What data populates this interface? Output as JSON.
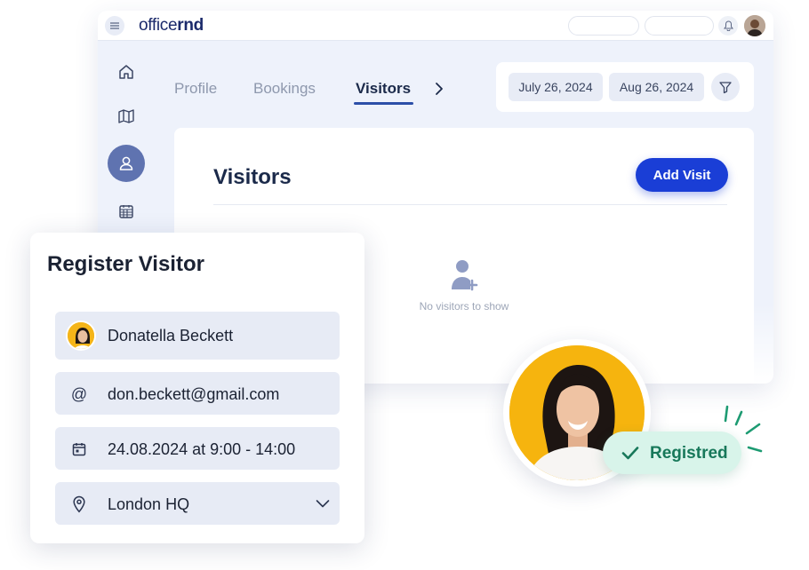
{
  "app": {
    "logo_regular": "office",
    "logo_bold": "rnd"
  },
  "tabs": [
    {
      "label": "Profile"
    },
    {
      "label": "Bookings"
    },
    {
      "label": "Visitors"
    }
  ],
  "filters": {
    "start_date": "July 26, 2024",
    "end_date": "Aug 26, 2024"
  },
  "visitors": {
    "title": "Visitors",
    "add_button": "Add Visit",
    "empty_text": "No visitors to show"
  },
  "register": {
    "title": "Register Visitor",
    "name": "Donatella Beckett",
    "email_icon": "@",
    "email": "don.beckett@gmail.com",
    "datetime": "24.08.2024 at 9:00 - 14:00",
    "location": "London HQ"
  },
  "status": {
    "label": "Registred"
  },
  "colors": {
    "accent": "#1a3ed6",
    "sidebar_active": "#5f73b0",
    "success_bg": "#d8f4ea",
    "success_text": "#17785a",
    "avatar_bg": "#f6b40e"
  }
}
